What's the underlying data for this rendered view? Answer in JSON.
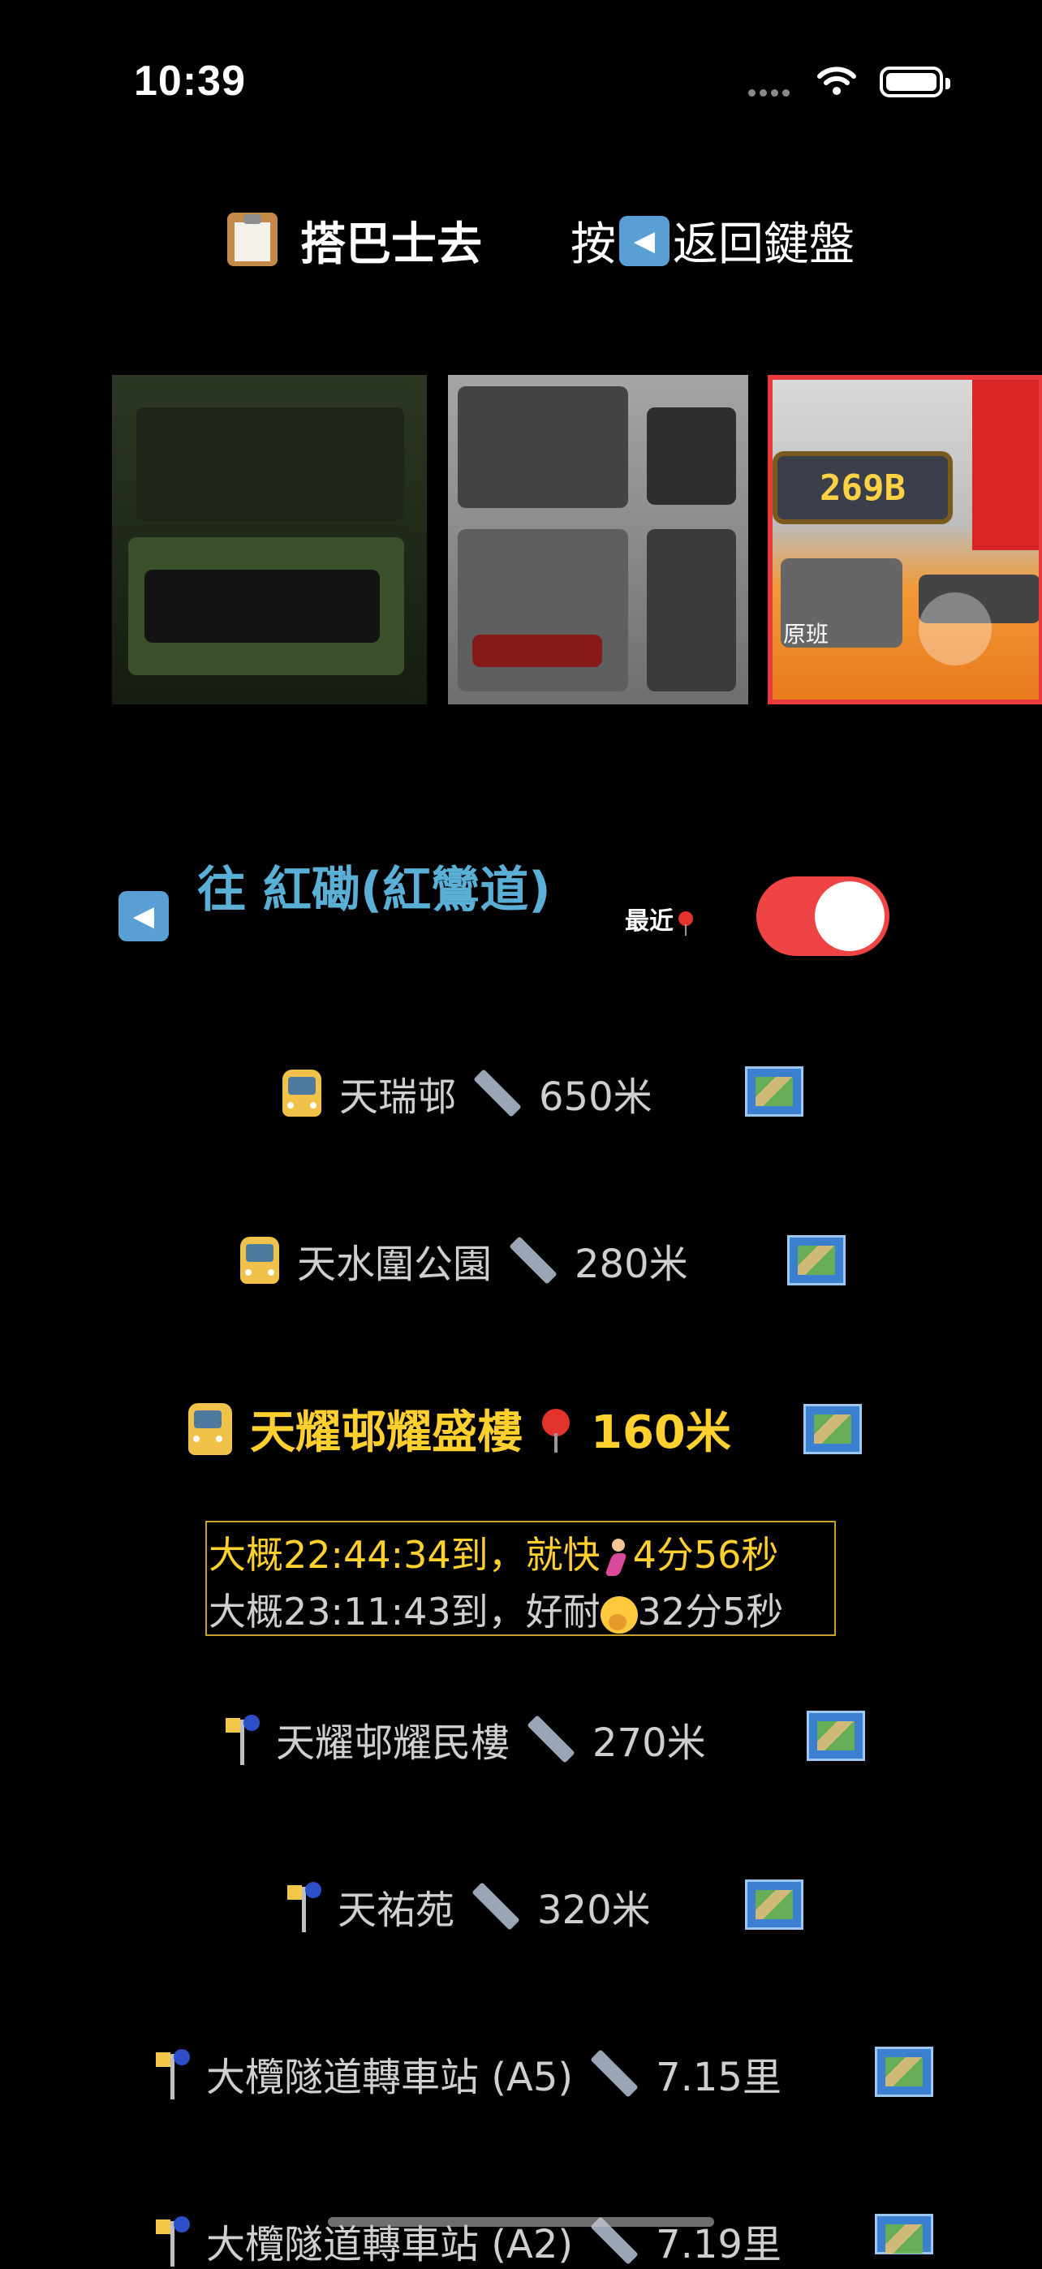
{
  "status_bar": {
    "time": "10:39"
  },
  "header": {
    "title": "搭巴士去",
    "hint_prefix": "按",
    "back_key_glyph": "◀",
    "hint_suffix": "返回鍵盤"
  },
  "carousel": {
    "selected_route": "269B",
    "selected_caption": "原班"
  },
  "direction": {
    "back_glyph": "◀",
    "label": "往 紅磡(紅鸞道)",
    "nearest_label": "最近",
    "nearest_toggle_on": true
  },
  "stops": [
    {
      "name": "天瑞邨",
      "distance": "650米",
      "icon": "bus-icon"
    },
    {
      "name": "天水圍公園",
      "distance": "280米",
      "icon": "bus-icon"
    },
    {
      "name": "天耀邨耀盛樓",
      "distance": "160米",
      "icon": "bus-icon",
      "current": true
    },
    {
      "name": "天耀邨耀民樓",
      "distance": "270米",
      "icon": "bus-stop-icon"
    },
    {
      "name": "天祐苑",
      "distance": "320米",
      "icon": "bus-stop-icon"
    },
    {
      "name": "大欖隧道轉車站 (A5)",
      "distance": "7.15里",
      "icon": "bus-stop-icon"
    },
    {
      "name": "大欖隧道轉車站 (A2)",
      "distance": "7.19里",
      "icon": "bus-stop-icon"
    }
  ],
  "eta": [
    {
      "prefix": "大概22:44:34到，就快",
      "suffix": "4分56秒"
    },
    {
      "prefix": "大概23:11:43到，好耐",
      "suffix": "32分5秒"
    }
  ]
}
